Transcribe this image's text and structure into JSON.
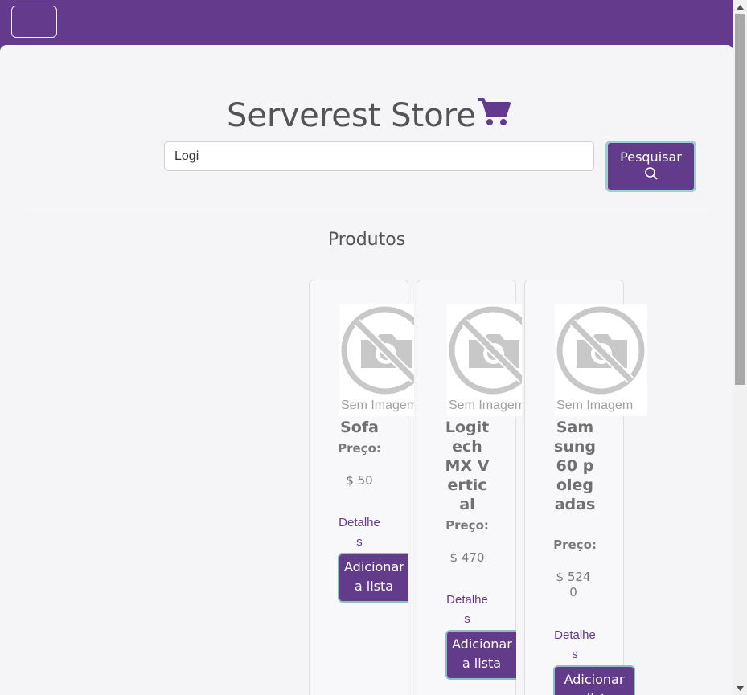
{
  "navbar": {
    "toggler_icon": "hamburger-icon"
  },
  "header": {
    "title": "Serverest Store",
    "icon": "cart-icon",
    "brand_color": "#643a8c"
  },
  "search": {
    "value": "Logi",
    "button_label": "Pesquisar",
    "button_icon": "search-icon"
  },
  "section": {
    "title": "Produtos"
  },
  "products": [
    {
      "name": "Sofa",
      "price_label": "Preço:",
      "price": "$ 50",
      "image_caption": "Sem Imagem",
      "details_label": "Detalhes",
      "add_label": "Adicionar a lista"
    },
    {
      "name": "Logitech MX Vertical",
      "price_label": "Preço:",
      "price": "$ 470",
      "image_caption": "Sem Imagem",
      "details_label": "Detalhes",
      "add_label": "Adicionar a lista"
    },
    {
      "name": "Samsung 60 polegadas",
      "price_label": "Preço:",
      "price": "$ 5240",
      "image_caption": "Sem Imagem",
      "details_label": "Detalhes",
      "add_label": "Adicionar a lista"
    }
  ]
}
